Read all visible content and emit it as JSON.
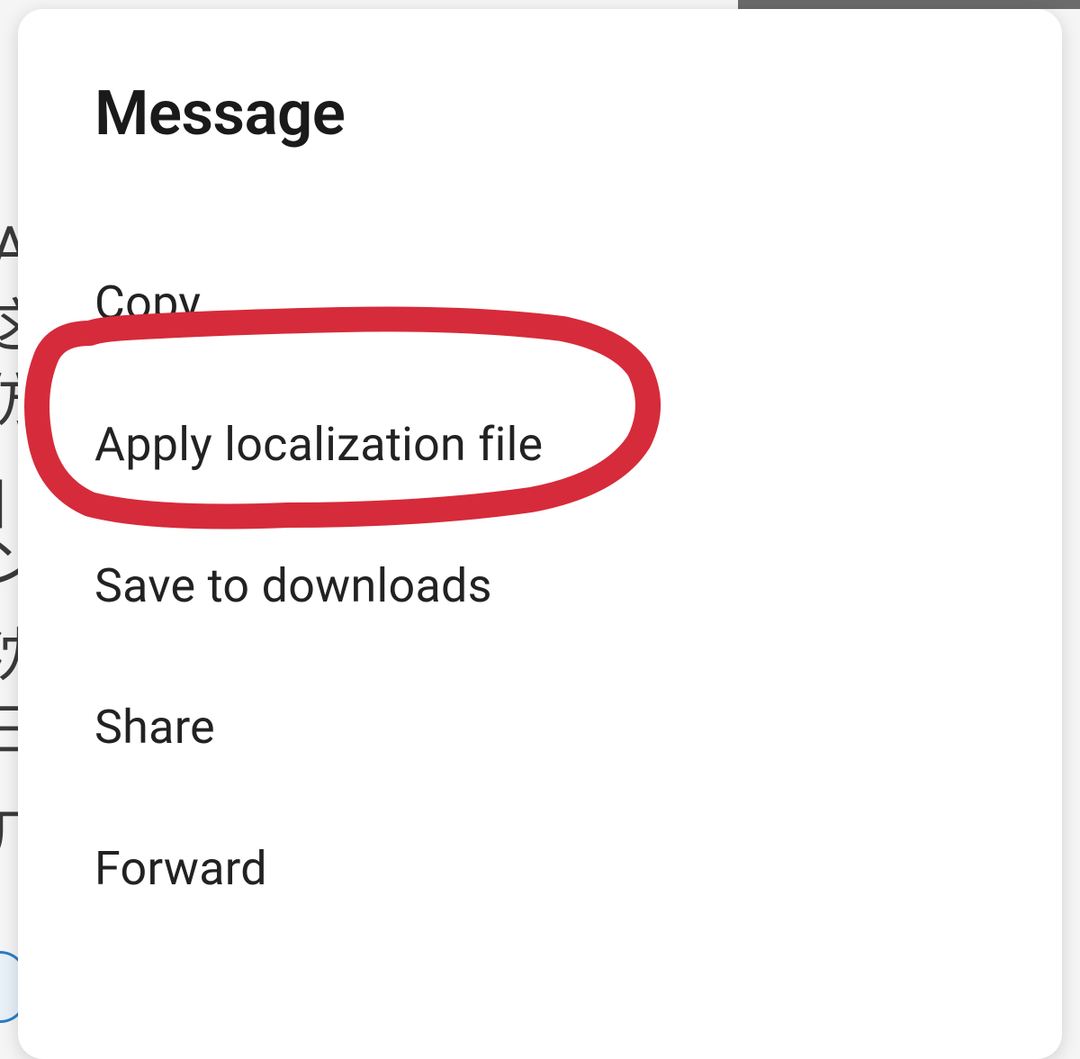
{
  "dialog": {
    "title": "Message",
    "menu_items": [
      {
        "label": "Copy"
      },
      {
        "label": "Apply localization file"
      },
      {
        "label": "Save to downloads"
      },
      {
        "label": "Share"
      },
      {
        "label": "Forward"
      }
    ]
  },
  "background": {
    "text_fragments": [
      "A",
      "这",
      "仿",
      "|",
      "ン",
      "沈",
      "日",
      "几"
    ]
  },
  "annotation": {
    "highlighted_item_index": 1,
    "color": "#d62b3a"
  }
}
